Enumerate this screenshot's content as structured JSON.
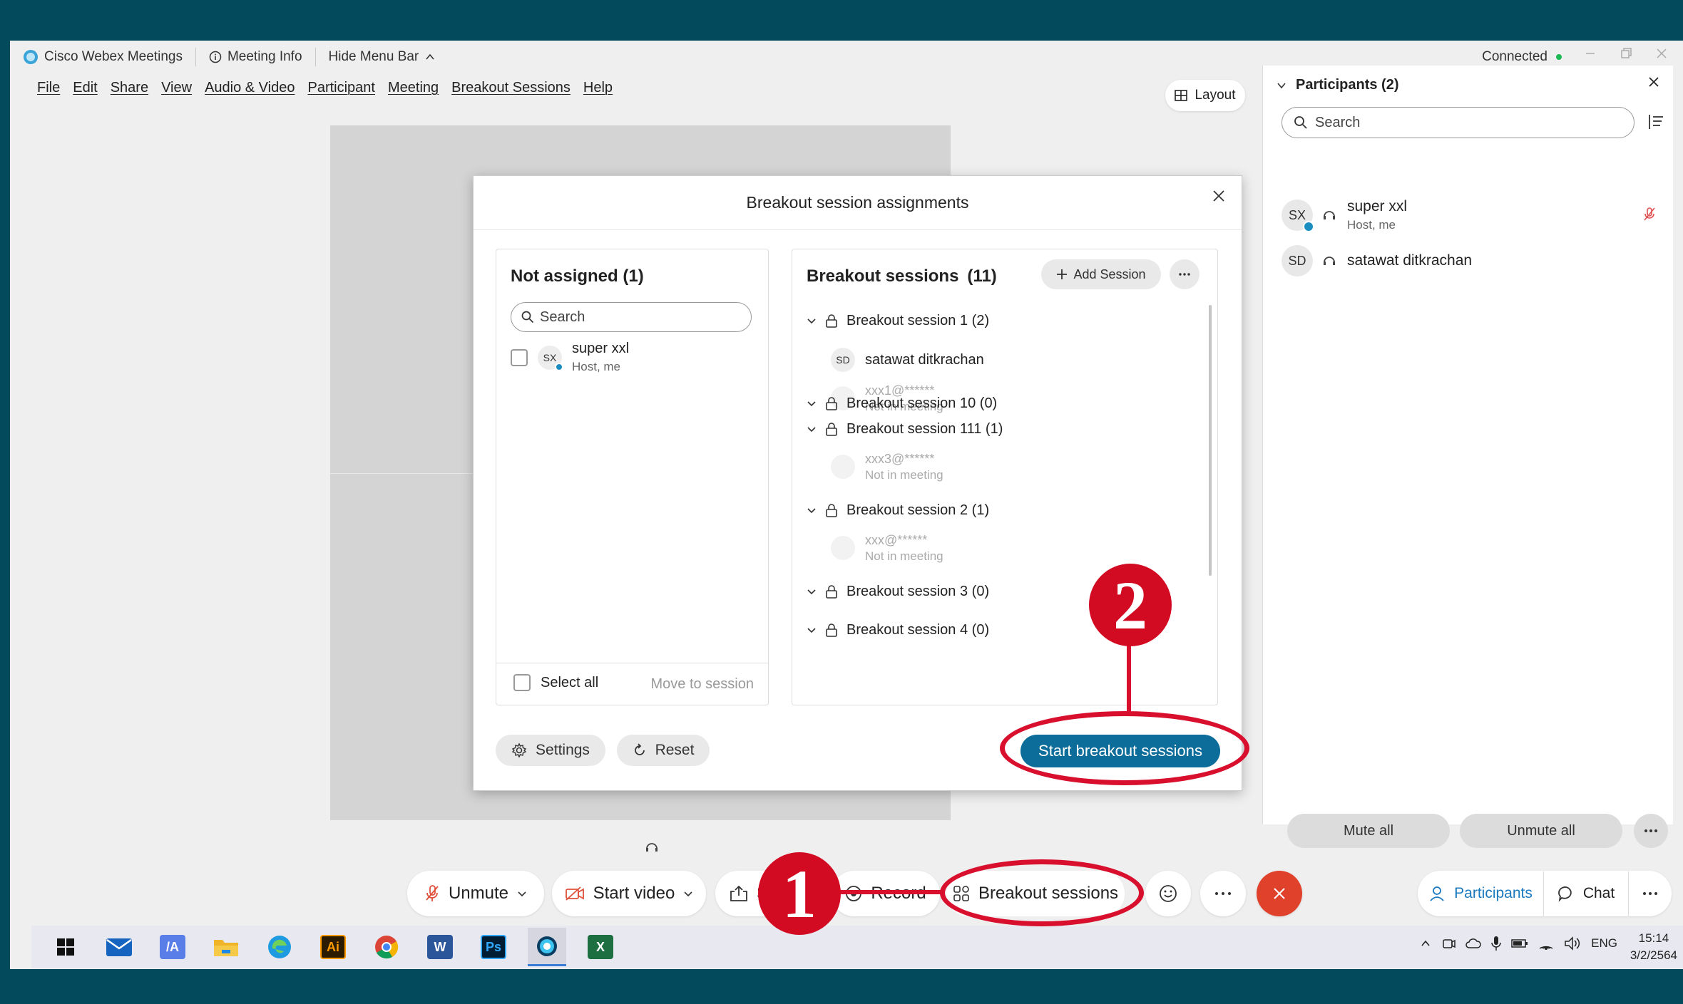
{
  "window": {
    "app_title": "Cisco Webex Meetings",
    "meeting_info": "Meeting Info",
    "hide_menu_bar": "Hide Menu Bar",
    "status": "Connected"
  },
  "menu": [
    "File",
    "Edit",
    "Share",
    "View",
    "Audio & Video",
    "Participant",
    "Meeting",
    "Breakout Sessions",
    "Help"
  ],
  "layout_button": "Layout",
  "participants_panel": {
    "title": "Participants (2)",
    "search_placeholder": "Search",
    "participants": [
      {
        "initials": "SX",
        "name": "super xxl",
        "subtitle": "Host, me"
      },
      {
        "initials": "SD",
        "name": "satawat ditkrachan",
        "subtitle": ""
      }
    ],
    "mute_all": "Mute all",
    "unmute_all": "Unmute all"
  },
  "dialog": {
    "title": "Breakout session assignments",
    "not_assigned": {
      "title": "Not assigned (1)",
      "search_placeholder": "Search",
      "member": {
        "initials": "SX",
        "name": "super xxl",
        "subtitle": "Host, me"
      },
      "select_all": "Select all",
      "move_to_session": "Move to session"
    },
    "sessions": {
      "title": "Breakout sessions",
      "count": "(11)",
      "add_session": "Add Session",
      "list": [
        {
          "label": "Breakout session 1 (2)",
          "members": [
            {
              "initials": "SD",
              "name": "satawat ditkrachan",
              "subtitle": "",
              "present": true
            },
            {
              "initials": "",
              "name": "xxx1@******",
              "subtitle": "Not in meeting",
              "present": false
            }
          ]
        },
        {
          "label": "Breakout session 10 (0)",
          "members": []
        },
        {
          "label": "Breakout session 111 (1)",
          "members": [
            {
              "initials": "",
              "name": "xxx3@******",
              "subtitle": "Not in meeting",
              "present": false
            }
          ]
        },
        {
          "label": "Breakout session 2 (1)",
          "members": [
            {
              "initials": "",
              "name": "xxx@******",
              "subtitle": "Not in meeting",
              "present": false
            }
          ]
        },
        {
          "label": "Breakout session 3 (0)",
          "members": []
        },
        {
          "label": "Breakout session 4 (0)",
          "members": []
        }
      ]
    },
    "settings": "Settings",
    "reset": "Reset",
    "start": "Start breakout sessions"
  },
  "toolbar": {
    "unmute": "Unmute",
    "start_video": "Start video",
    "share_partial": "S",
    "record": "Record",
    "breakout_sessions": "Breakout sessions",
    "participants": "Participants",
    "chat": "Chat"
  },
  "taskbar": {
    "time": "15:14",
    "date": "3/2/2564",
    "language": "ENG"
  },
  "annotations": {
    "step1": "1",
    "step2": "2",
    "color": "#d8102e"
  }
}
